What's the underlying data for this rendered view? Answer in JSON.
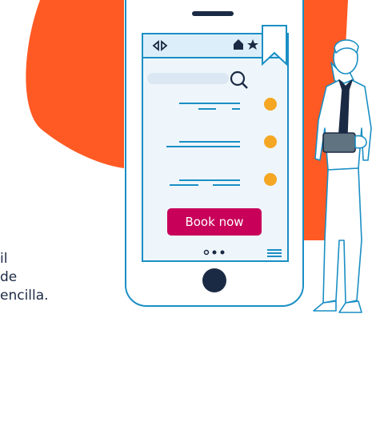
{
  "side_text": [
    "il",
    "de",
    "encilla."
  ],
  "phone": {
    "book_button_label": "Book now"
  },
  "icons": {
    "nav": "back-forward-icon",
    "home": "home-icon",
    "bookmark": "star-icon",
    "download": "download-icon",
    "search": "search-icon",
    "pagination": "dots-icon",
    "menu": "hamburger-icon"
  },
  "colors": {
    "accent_orange": "#ff5a24",
    "brand_blue": "#1a8fc4",
    "phone_screen": "#eef6fb",
    "item_dot": "#f5a623",
    "cta": "#c8005a",
    "text": "#1b2a44"
  }
}
